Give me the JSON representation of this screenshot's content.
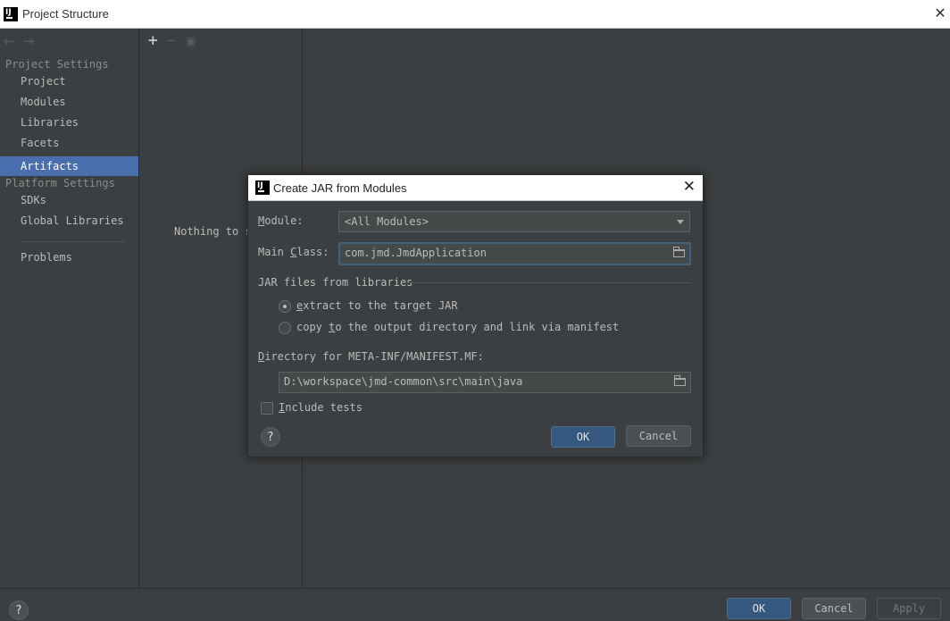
{
  "window": {
    "title": "Project Structure"
  },
  "nav": {
    "back": "←",
    "forward": "→"
  },
  "sidebar": {
    "project_settings_heading": "Project Settings",
    "platform_settings_heading": "Platform Settings",
    "items": [
      {
        "label": "Project"
      },
      {
        "label": "Modules"
      },
      {
        "label": "Libraries"
      },
      {
        "label": "Facets"
      },
      {
        "label": "Artifacts",
        "selected": true
      },
      {
        "label": "SDKs"
      },
      {
        "label": "Global Libraries"
      },
      {
        "label": "Problems"
      }
    ]
  },
  "middle": {
    "add": "+",
    "remove": "−",
    "empty_text": "Nothing to s"
  },
  "dialog": {
    "title": "Create JAR from Modules",
    "module_label_pre": "",
    "module_label_mn": "M",
    "module_label_post": "odule:",
    "module_value": "<All Modules>",
    "main_class_label_pre": "Main ",
    "main_class_label_mn": "C",
    "main_class_label_post": "lass:",
    "main_class_value": "com.jmd.JmdApplication",
    "jar_files_heading": "JAR files from libraries",
    "extract_pre": "",
    "extract_mn": "e",
    "extract_post": "xtract to the target JAR",
    "copy_pre": "copy ",
    "copy_mn": "t",
    "copy_post": "o the output directory and link via manifest",
    "selected_option": "extract",
    "directory_label_pre": "",
    "directory_label_mn": "D",
    "directory_label_post": "irectory for META-INF/MANIFEST.MF:",
    "directory_value": "D:\\workspace\\jmd-common\\src\\main\\java",
    "include_tests_pre": "",
    "include_tests_mn": "I",
    "include_tests_post": "nclude tests",
    "include_tests_checked": false,
    "help": "?",
    "ok": "OK",
    "cancel": "Cancel"
  },
  "footer": {
    "help": "?",
    "ok": "OK",
    "cancel": "Cancel",
    "apply": "Apply"
  },
  "colors": {
    "background": "#3c3f41",
    "selection": "#4b6eaf",
    "primary_button": "#365880"
  }
}
